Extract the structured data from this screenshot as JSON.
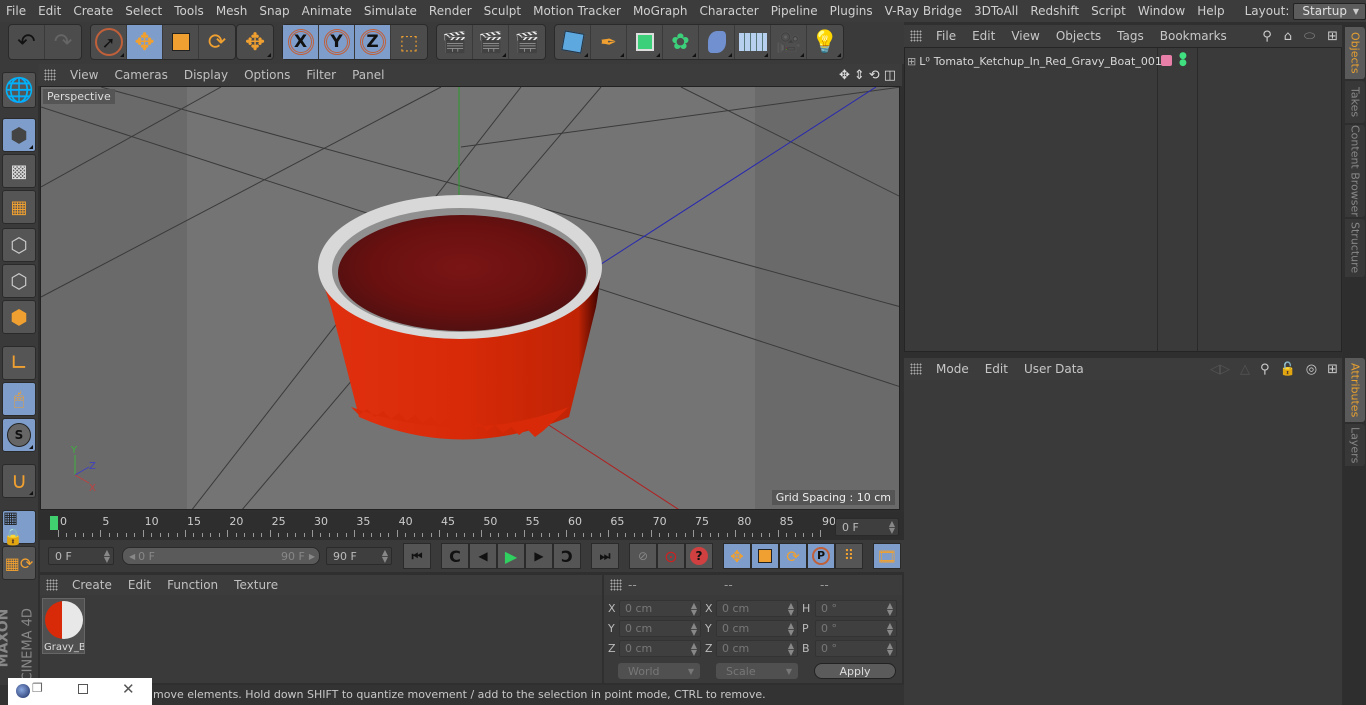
{
  "menubar": {
    "items": [
      "File",
      "Edit",
      "Create",
      "Select",
      "Tools",
      "Mesh",
      "Snap",
      "Animate",
      "Simulate",
      "Render",
      "Sculpt",
      "Motion Tracker",
      "MoGraph",
      "Character",
      "Pipeline",
      "Plugins",
      "V-Ray Bridge",
      "3DToAll",
      "Redshift",
      "Script",
      "Window",
      "Help"
    ],
    "layout_label": "Layout:",
    "layout_value": "Startup"
  },
  "viewport": {
    "menu": [
      "View",
      "Cameras",
      "Display",
      "Options",
      "Filter",
      "Panel"
    ],
    "camera_label": "Perspective",
    "grid_spacing": "Grid Spacing : 10 cm",
    "axis": {
      "x": "X",
      "y": "Y",
      "z": "Z"
    }
  },
  "toolbar": {
    "axis_x": "X",
    "axis_y": "Y",
    "axis_z": "Z"
  },
  "timeline": {
    "ticks": [
      "0",
      "5",
      "10",
      "15",
      "20",
      "25",
      "30",
      "35",
      "40",
      "45",
      "50",
      "55",
      "60",
      "65",
      "70",
      "75",
      "80",
      "85",
      "90"
    ],
    "current_frame_right": "0 F",
    "start_field": "0 F",
    "range_start": "0 F",
    "range_end": "90 F",
    "end_field": "90 F"
  },
  "materials": {
    "menu": [
      "Create",
      "Edit",
      "Function",
      "Texture"
    ],
    "items": [
      {
        "name": "Gravy_B"
      }
    ]
  },
  "coordinates": {
    "headers": [
      "--",
      "--",
      "--"
    ],
    "rows": [
      {
        "l1": "X",
        "v1": "0 cm",
        "l2": "X",
        "v2": "0 cm",
        "l3": "H",
        "v3": "0 °"
      },
      {
        "l1": "Y",
        "v1": "0 cm",
        "l2": "Y",
        "v2": "0 cm",
        "l3": "P",
        "v3": "0 °"
      },
      {
        "l1": "Z",
        "v1": "0 cm",
        "l2": "Z",
        "v2": "0 cm",
        "l3": "B",
        "v3": "0 °"
      }
    ],
    "mode_select": "World",
    "type_select": "Scale",
    "apply": "Apply"
  },
  "objects": {
    "menu": [
      "File",
      "Edit",
      "View",
      "Objects",
      "Tags",
      "Bookmarks"
    ],
    "tree": [
      {
        "name": "Tomato_Ketchup_In_Red_Gravy_Boat_001",
        "tag_color": "#e87fa8"
      }
    ]
  },
  "attributes": {
    "menu": [
      "Mode",
      "Edit",
      "User Data"
    ]
  },
  "side_tabs": {
    "top": [
      "Objects",
      "Takes",
      "Content Browser",
      "Structure"
    ],
    "bottom": [
      "Attributes",
      "Layers"
    ]
  },
  "status": {
    "text": "move elements. Hold down SHIFT to quantize movement / add to the selection in point mode, CTRL to remove."
  },
  "brand": {
    "line1": "MAXON",
    "line2": "CINEMA 4D"
  },
  "colors": {
    "accent": "#7e9dcb",
    "tab_active": "#e8a030",
    "icon_orange": "#f0a030"
  }
}
